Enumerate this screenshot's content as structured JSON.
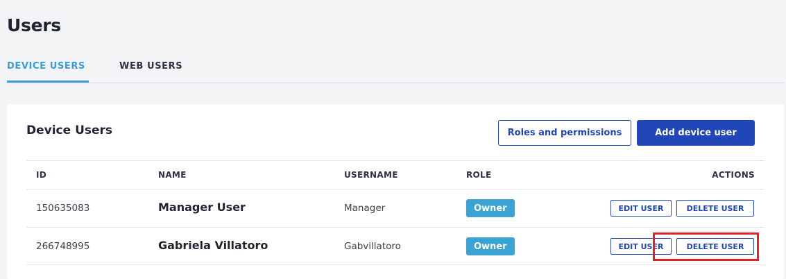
{
  "page": {
    "title": "Users"
  },
  "tabs": [
    {
      "label": "DEVICE USERS",
      "active": true
    },
    {
      "label": "WEB USERS",
      "active": false
    }
  ],
  "card": {
    "title": "Device Users",
    "roles_button": "Roles and permissions",
    "add_button": "Add device user"
  },
  "table": {
    "columns": [
      "ID",
      "NAME",
      "USERNAME",
      "ROLE",
      "ACTIONS"
    ],
    "rows": [
      {
        "id": "150635083",
        "name": "Manager User",
        "username": "Manager",
        "role": "Owner",
        "edit": "EDIT USER",
        "delete": "DELETE USER"
      },
      {
        "id": "266748995",
        "name": "Gabriela Villatoro",
        "username": "Gabvillatoro",
        "role": "Owner",
        "edit": "EDIT USER",
        "delete": "DELETE USER"
      }
    ]
  },
  "colors": {
    "accent_tab": "#3b9ad9",
    "primary": "#2146b8",
    "badge": "#3aa3d4",
    "highlight": "#e0202a"
  }
}
